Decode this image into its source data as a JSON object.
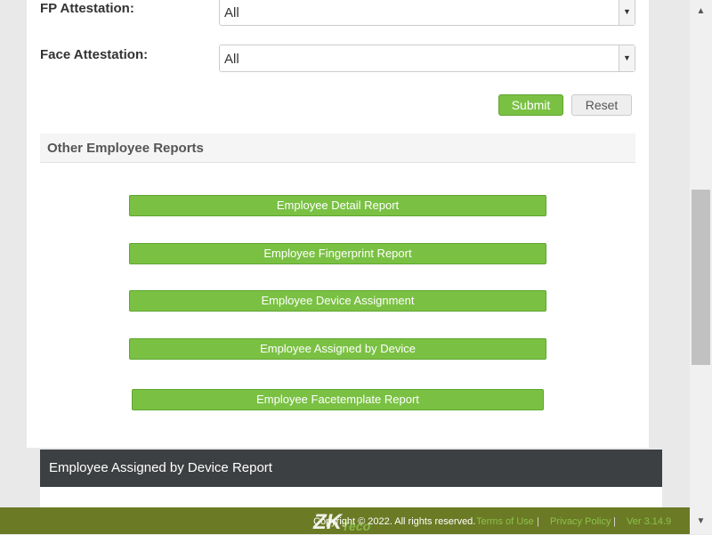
{
  "form": {
    "fp_label": "FP Attestation:",
    "fp_value": "All",
    "face_label": "Face Attestation:",
    "face_value": "All",
    "submit": "Submit",
    "reset": "Reset"
  },
  "other": {
    "title": "Other Employee Reports",
    "buttons": [
      "Employee Detail Report",
      "Employee Fingerprint Report",
      "Employee Device Assignment",
      "Employee Assigned by Device",
      "Employee Facetemplate Report"
    ]
  },
  "report_header": "Employee Assigned by Device Report",
  "footer": {
    "logo": "ZKTeco",
    "copyright": "Copyright © 2022. All rights reserved.",
    "terms": "Terms of Use",
    "privacy": "Privacy Policy",
    "version": "Ver 3.14.9"
  },
  "colors": {
    "accent": "#7ac143",
    "footer": "#6b7a25",
    "dark_header": "#3d4042"
  }
}
